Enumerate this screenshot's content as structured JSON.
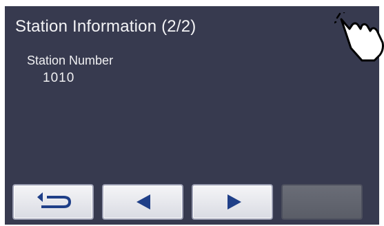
{
  "screen": {
    "title": "Station Information (2/2)",
    "field": {
      "label": "Station Number",
      "value": "1010"
    }
  },
  "buttons": [
    {
      "name": "back-button",
      "icon": "return-arrow-icon",
      "enabled": true
    },
    {
      "name": "previous-button",
      "icon": "triangle-left-icon",
      "enabled": true
    },
    {
      "name": "next-button",
      "icon": "triangle-right-icon",
      "enabled": true
    },
    {
      "name": "blank-button",
      "icon": "",
      "enabled": false
    }
  ],
  "colors": {
    "screen_background": "#373a4f",
    "text": "#f4f4f6",
    "icon": "#1f3f88",
    "button_face": "#eef0f4",
    "button_disabled": "#63666f"
  }
}
